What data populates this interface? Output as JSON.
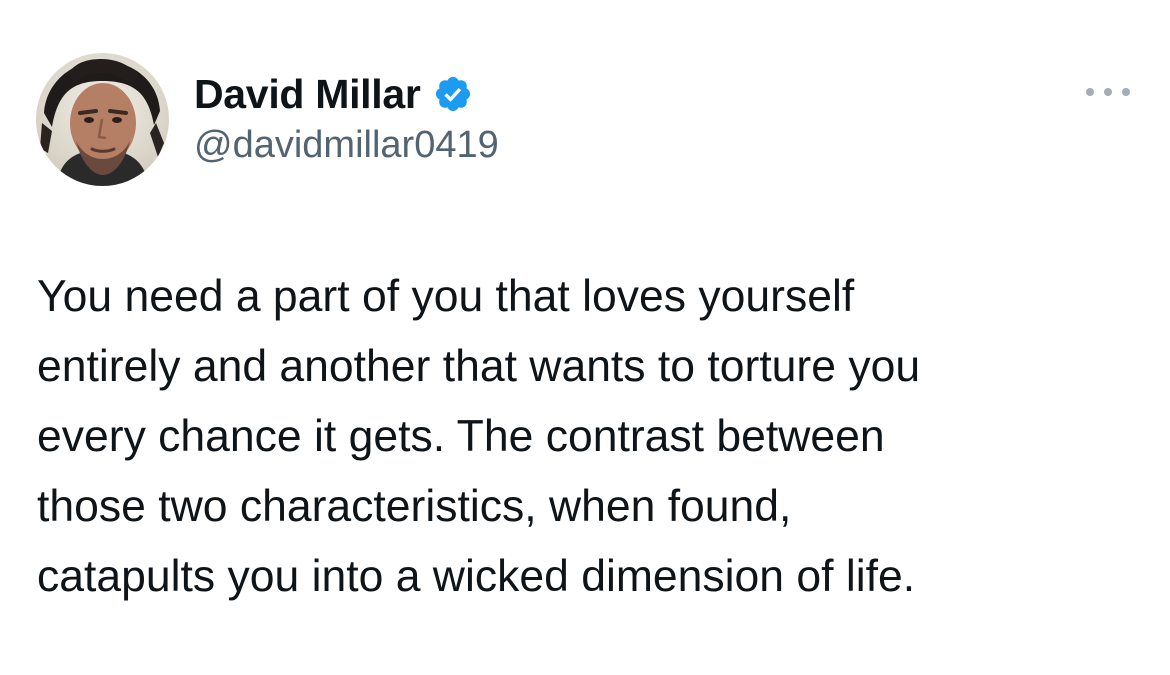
{
  "author": {
    "display_name": "David Millar",
    "handle": "@davidmillar0419",
    "verified": true
  },
  "tweet": {
    "text_lines": [
      "You need a part of you that loves yourself",
      "entirely and another that wants to torture you",
      "every chance it gets. The contrast between",
      "those two characteristics, when found,",
      "catapults you into a wicked dimension of life."
    ]
  },
  "icons": {
    "verified": "verified-badge-icon",
    "more": "more-options-icon"
  },
  "colors": {
    "text": "#0f1419",
    "secondary": "#536471",
    "verified": "#1d9bf0",
    "more_dots": "#a3adb5"
  }
}
